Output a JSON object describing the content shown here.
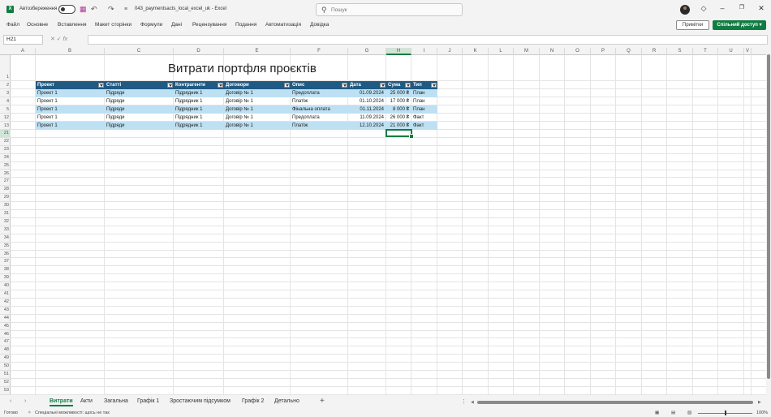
{
  "titlebar": {
    "autosave_label": "Автозбереження",
    "document_title": "043_paymentsacts_local_excel_uk  -  Excel",
    "search_placeholder": "Пошук"
  },
  "menu": [
    "Файл",
    "Основне",
    "Вставлення",
    "Макет сторінки",
    "Формули",
    "Дані",
    "Рецензування",
    "Подання",
    "Автоматизація",
    "Довідка"
  ],
  "actions": {
    "comments": "Примітки",
    "share": "Спільний доступ"
  },
  "formula_bar": {
    "name_box": "H21",
    "fx_label": "fx",
    "value": ""
  },
  "columns": [
    "A",
    "B",
    "C",
    "D",
    "E",
    "F",
    "G",
    "H",
    "I",
    "J",
    "K",
    "L",
    "M",
    "N",
    "O",
    "P",
    "Q",
    "R",
    "S",
    "T",
    "U",
    "V"
  ],
  "rows": [
    "1",
    "2",
    "3",
    "4",
    "5",
    "12",
    "13",
    "21",
    "22",
    "23",
    "24",
    "25",
    "26",
    "27",
    "28",
    "29",
    "30",
    "31",
    "32",
    "33",
    "34",
    "35",
    "36",
    "37",
    "38",
    "39",
    "40",
    "41",
    "42",
    "43",
    "44",
    "45",
    "46",
    "47",
    "48",
    "49",
    "50",
    "51",
    "52",
    "53"
  ],
  "sheet_title": "Витрати портфля проєктів",
  "table": {
    "headers": [
      "Проект",
      "Статті",
      "Контрагенти",
      "Договори",
      "Опис",
      "Дата",
      "Сума",
      "Тип"
    ],
    "rows": [
      [
        "Проект 1",
        "Підряди",
        "Підрядник 1",
        "Договір № 1",
        "Предоплата",
        "01.09.2024",
        "25 000 ₴",
        "План"
      ],
      [
        "Проект 1",
        "Підряди",
        "Підрядник 1",
        "Договір № 1",
        "Платіж",
        "01.10.2024",
        "17 000 ₴",
        "План"
      ],
      [
        "Проект 1",
        "Підряди",
        "Підрядник 1",
        "Договір № 1",
        "Фінальна оплата",
        "01.11.2024",
        "8 000 ₴",
        "План"
      ],
      [
        "Проект 1",
        "Підряди",
        "Підрядник 1",
        "Договір № 1",
        "Предоплата",
        "11.09.2024",
        "26 000 ₴",
        "Факт"
      ],
      [
        "Проект 1",
        "Підряди",
        "Підрядник 1",
        "Договір № 1",
        "Платіж",
        "12.10.2024",
        "21 000 ₴",
        "Факт"
      ]
    ]
  },
  "sheet_tabs": [
    "Витрати",
    "Акти",
    "Загальна",
    "Графік 1",
    "Зростаючим підсумком",
    "Графік 2",
    "Детально"
  ],
  "status": {
    "ready": "Готово",
    "accessibility": "Спеціальні можливості: щось не так",
    "zoom": "100%"
  },
  "colors": {
    "accent": "#107c41",
    "table_header": "#1f5a84",
    "band": "#bde0f2"
  }
}
